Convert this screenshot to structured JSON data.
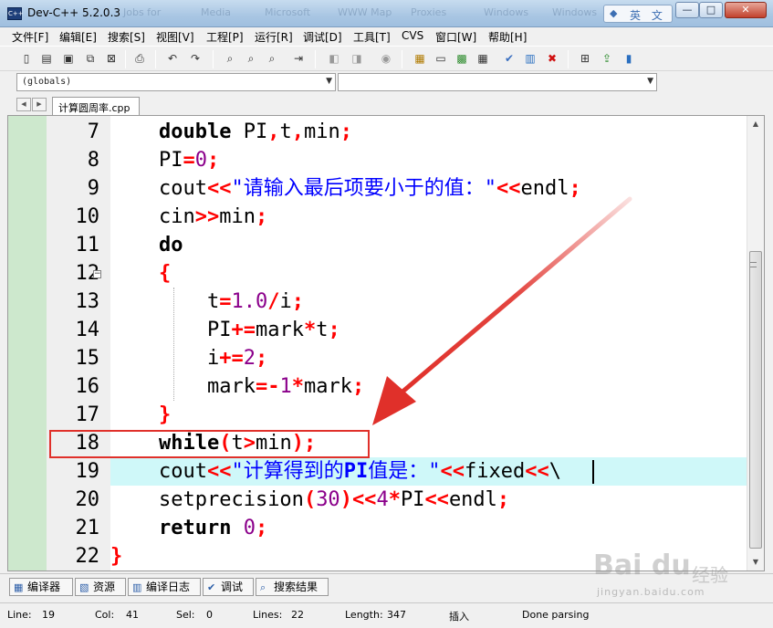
{
  "window": {
    "title": "Dev-C++ 5.2.0.3",
    "ime_label": "英 文",
    "minimize": "—",
    "maximize": "□",
    "close": "✕",
    "ghost_titles": [
      "Jobs for",
      "Media",
      "Microsoft",
      "WWW Map",
      "Proxies",
      "Windows",
      "Windows"
    ]
  },
  "menu": [
    "文件[F]",
    "编辑[E]",
    "搜索[S]",
    "视图[V]",
    "工程[P]",
    "运行[R]",
    "调试[D]",
    "工具[T]",
    "CVS",
    "窗口[W]",
    "帮助[H]"
  ],
  "toolbar": {
    "icons": [
      "new-file-icon",
      "open-file-icon",
      "save-icon",
      "save-all-icon",
      "close-file-icon",
      "print-icon",
      "undo-icon",
      "redo-icon",
      "find-icon",
      "replace-icon",
      "find-next-icon",
      "goto-line-icon",
      "compile-icon",
      "run-icon",
      "compile-run-icon",
      "debug-icon",
      "project-icon",
      "class-icon",
      "grid-icon",
      "tiles-icon",
      "check-icon",
      "chart-icon",
      "delete-icon",
      "add-icon",
      "export-icon",
      "bookmark-icon"
    ]
  },
  "class_browser": {
    "scope": "(globals)",
    "member": ""
  },
  "tabs": {
    "file": "计算圆周率.cpp"
  },
  "editor": {
    "lines": [
      7,
      8,
      9,
      10,
      11,
      12,
      13,
      14,
      15,
      16,
      17,
      18,
      19,
      20,
      21,
      22
    ],
    "fold_marker": "−",
    "code": {
      "l7_kw": "double",
      "l7_rest_a": " PI",
      "l7_c1": ",",
      "l7_rest_b": "t",
      "l7_c2": ",",
      "l7_rest_c": "min",
      "l7_semi": ";",
      "l8_id": "PI",
      "l8_op": "=",
      "l8_num": "0",
      "l8_semi": ";",
      "l9_id": "cout",
      "l9_op": "<<",
      "l9_str": "\"请输入最后项要小于的值：\"",
      "l9_op2": "<<",
      "l9_end": "endl",
      "l9_semi": ";",
      "l10_id": "cin",
      "l10_op": ">>",
      "l10_var": "min",
      "l10_semi": ";",
      "l11_kw": "do",
      "l12_brace": "{",
      "l13_a": "t",
      "l13_op": "=",
      "l13_num": "1.0",
      "l13_div": "/",
      "l13_b": "i",
      "l13_semi": ";",
      "l14_a": "PI",
      "l14_op": "+=",
      "l14_b": "mark",
      "l14_mul": "*",
      "l14_c": "t",
      "l14_semi": ";",
      "l15_a": "i",
      "l15_op": "+=",
      "l15_num": "2",
      "l15_semi": ";",
      "l16_a": "mark",
      "l16_op": "=-",
      "l16_num": "1",
      "l16_mul": "*",
      "l16_b": "mark",
      "l16_semi": ";",
      "l17_brace": "}",
      "l18_kw": "while",
      "l18_p1": "(",
      "l18_a": "t",
      "l18_op": ">",
      "l18_b": "min",
      "l18_p2": ")",
      "l18_semi": ";",
      "l19_id": "cout",
      "l19_op": "<<",
      "l19_str_a": "\"计算得到的",
      "l19_str_b": "PI",
      "l19_str_c": "值是：\"",
      "l19_op2": "<<",
      "l19_fixed": "fixed",
      "l19_op3": "<<",
      "l19_bs": "\\",
      "l20_fn": "setprecision",
      "l20_p1": "(",
      "l20_num": "30",
      "l20_p2": ")",
      "l20_op": "<<",
      "l20_num2": "4",
      "l20_mul": "*",
      "l20_pi": "PI",
      "l20_op2": "<<",
      "l20_end": "endl",
      "l20_semi": ";",
      "l21_kw": "return",
      "l21_num": " 0",
      "l21_semi": ";",
      "l22_brace": "}"
    }
  },
  "bottom_tabs": [
    {
      "icon": "compiler-icon",
      "label": "编译器"
    },
    {
      "icon": "resources-icon",
      "label": "资源"
    },
    {
      "icon": "compile-log-icon",
      "label": "编译日志"
    },
    {
      "icon": "debug-icon",
      "label": "调试"
    },
    {
      "icon": "search-results-icon",
      "label": "搜索结果"
    }
  ],
  "status": {
    "line_label": "Line:",
    "line": "19",
    "col_label": "Col:",
    "col": "41",
    "sel_label": "Sel:",
    "sel": "0",
    "lines_label": "Lines:",
    "lines": "22",
    "length_label": "Length:",
    "length": "347",
    "mode": "插入",
    "message": "Done parsing"
  },
  "watermark": {
    "logo": "Bai du",
    "cn": "经验",
    "url": "jingyan.baidu.com"
  },
  "colors": {
    "keyword": "#000000",
    "operator": "#ff0000",
    "number": "#8b008b",
    "string": "#0000ff",
    "active_line": "#cff8f9",
    "gutter": "#cde8cd",
    "annotation": "#e0302a"
  }
}
